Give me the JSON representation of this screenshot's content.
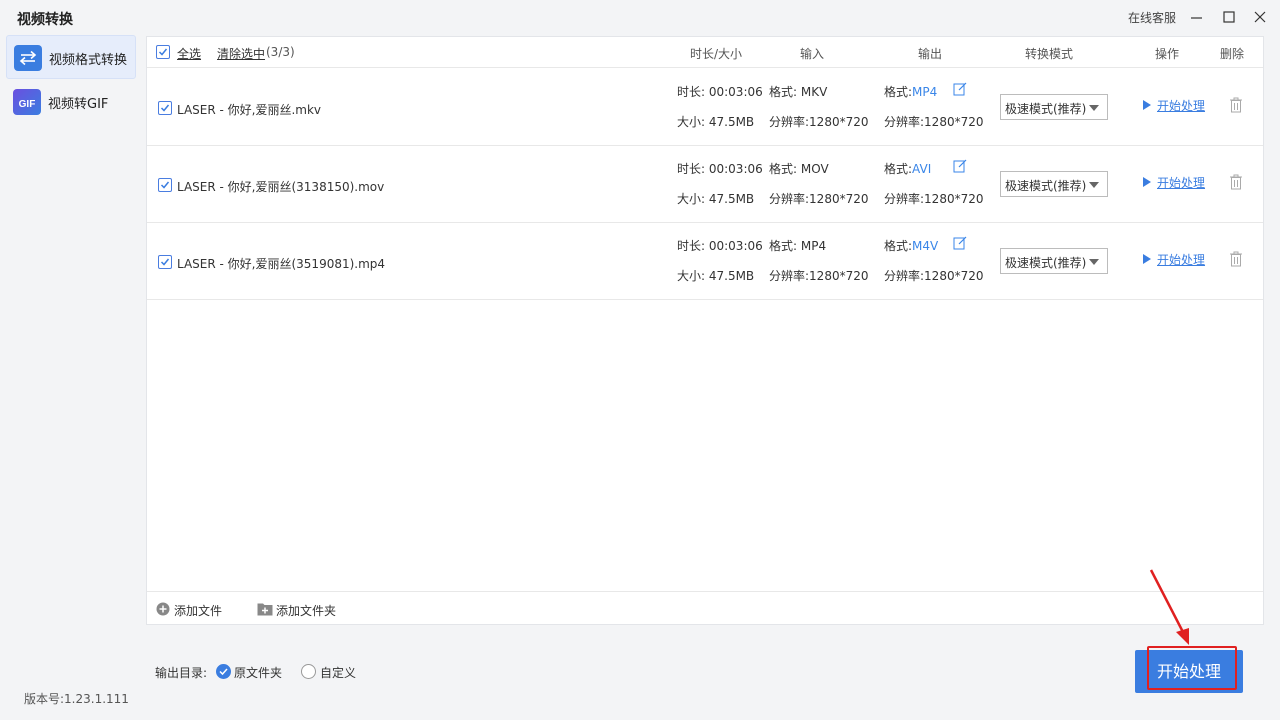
{
  "app": {
    "title": "视频转换",
    "support": "在线客服",
    "version": "版本号:1.23.1.111"
  },
  "sidebar": {
    "items": [
      {
        "label": "视频格式转换",
        "icon": "swap-icon"
      },
      {
        "label": "视频转GIF",
        "icon": "gif-icon"
      }
    ]
  },
  "header": {
    "select_all": "全选",
    "clear_selection": "清除选中",
    "count": "(3/3)",
    "columns": {
      "duration_size": "时长/大小",
      "input": "输入",
      "output": "输出",
      "mode": "转换模式",
      "action": "操作",
      "delete": "删除"
    }
  },
  "files": [
    {
      "name": "LASER - 你好,爱丽丝.mkv",
      "duration": "时长: 00:03:06",
      "size": "大小: 47.5MB",
      "in_format": "格式: MKV",
      "in_res": "分辨率:1280*720",
      "out_prefix": "格式:",
      "out_format": "MP4",
      "out_res": "分辨率:1280*720",
      "mode": "极速模式(推荐)",
      "action": "开始处理"
    },
    {
      "name": "LASER - 你好,爱丽丝(3138150).mov",
      "duration": "时长: 00:03:06",
      "size": "大小: 47.5MB",
      "in_format": "格式: MOV",
      "in_res": "分辨率:1280*720",
      "out_prefix": "格式:",
      "out_format": "AVI",
      "out_res": "分辨率:1280*720",
      "mode": "极速模式(推荐)",
      "action": "开始处理"
    },
    {
      "name": "LASER - 你好,爱丽丝(3519081).mp4",
      "duration": "时长: 00:03:06",
      "size": "大小: 47.5MB",
      "in_format": "格式: MP4",
      "in_res": "分辨率:1280*720",
      "out_prefix": "格式:",
      "out_format": "M4V",
      "out_res": "分辨率:1280*720",
      "mode": "极速模式(推荐)",
      "action": "开始处理"
    }
  ],
  "footer": {
    "add_file": "添加文件",
    "add_folder": "添加文件夹"
  },
  "output_dir": {
    "label": "输出目录:",
    "option_original": "原文件夹",
    "option_custom": "自定义",
    "selected": "原文件夹"
  },
  "start_button": "开始处理",
  "colors": {
    "accent": "#3a7de0",
    "highlight": "#e02020"
  }
}
